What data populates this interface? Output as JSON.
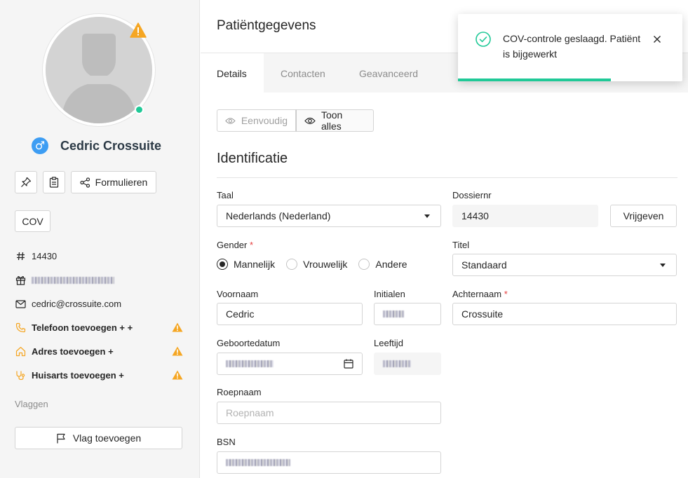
{
  "sidebar": {
    "patient_name": "Cedric Crossuite",
    "gender_symbol": "♂",
    "forms_label": "Formulieren",
    "cov_label": "COV",
    "info": {
      "dossier_number": "14430",
      "email": "cedric@crossuite.com",
      "add_phone": "Telefoon toevoegen + +",
      "add_address": "Adres toevoegen +",
      "add_gp": "Huisarts toevoegen +"
    },
    "flags_label": "Vlaggen",
    "add_flag_label": "Vlag toevoegen"
  },
  "main": {
    "page_title": "Patiëntgegevens",
    "tabs": [
      {
        "label": "Details",
        "active": true
      },
      {
        "label": "Contacten",
        "active": false
      },
      {
        "label": "Geavanceerd",
        "active": false
      }
    ],
    "view_toggle": {
      "simple": "Eenvoudig",
      "all": "Toon alles"
    },
    "section_title": "Identificatie",
    "form": {
      "language_label": "Taal",
      "language_value": "Nederlands (Nederland)",
      "dossier_label": "Dossiernr",
      "dossier_value": "14430",
      "release_button": "Vrijgeven",
      "gender_label": "Gender",
      "gender_options": [
        "Mannelijk",
        "Vrouwelijk",
        "Andere"
      ],
      "gender_selected": "Mannelijk",
      "title_label": "Titel",
      "title_value": "Standaard",
      "firstname_label": "Voornaam",
      "firstname_value": "Cedric",
      "initials_label": "Initialen",
      "lastname_label": "Achternaam",
      "lastname_value": "Crossuite",
      "birthdate_label": "Geboortedatum",
      "age_label": "Leeftijd",
      "nickname_label": "Roepnaam",
      "nickname_placeholder": "Roepnaam",
      "bsn_label": "BSN",
      "required_mark": "*"
    }
  },
  "toast": {
    "message": "COV-controle geslaagd. Patiënt is bijgewerkt",
    "progress": 0.68
  },
  "colors": {
    "accent_green": "#20c997",
    "warning_orange": "#f5a623",
    "gender_blue": "#3d9df3",
    "required_red": "#e53e3e"
  }
}
